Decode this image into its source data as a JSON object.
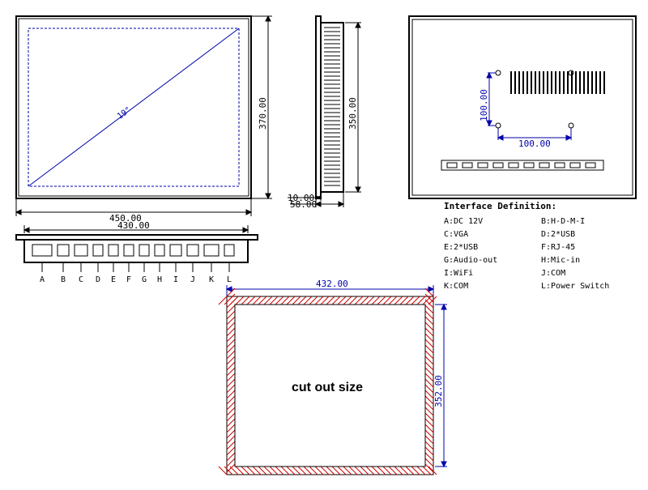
{
  "diagonal": "19\"",
  "front": {
    "width": "450.00",
    "height": "370.00"
  },
  "side": {
    "thickness": "58.00",
    "bezel": "10.00",
    "height": "350.00"
  },
  "rear": {
    "vesa_h": "100.00",
    "vesa_v": "100.00"
  },
  "ports": {
    "width": "430.00",
    "letters": [
      "A",
      "B",
      "C",
      "D",
      "E",
      "F",
      "G",
      "H",
      "I",
      "J",
      "K",
      "L"
    ]
  },
  "cutout": {
    "width": "432.00",
    "height": "352.00",
    "label": "cut out size"
  },
  "iface_title": "Interface Definition:",
  "iface_left": [
    "A:DC 12V",
    "C:VGA",
    "E:2*USB",
    "G:Audio-out",
    "I:WiFi",
    "K:COM"
  ],
  "iface_right": [
    "B:H-D-M-I",
    "D:2*USB",
    "F:RJ-45",
    "H:Mic-in",
    "J:COM",
    "L:Power Switch"
  ]
}
